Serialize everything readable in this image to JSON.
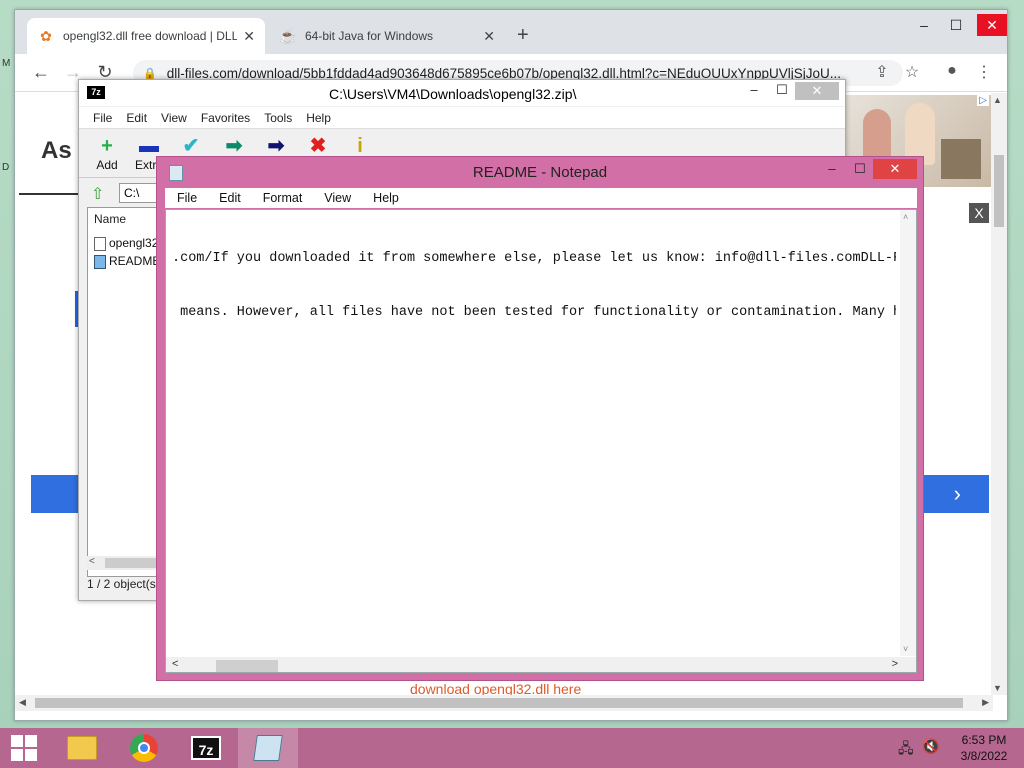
{
  "desktop": {
    "edge_labels": [
      "M",
      "D"
    ]
  },
  "browser": {
    "tabs": [
      {
        "title": "opengl32.dll free download | DLL",
        "icon": "dll-files-gear-icon"
      },
      {
        "title": "64-bit Java for Windows",
        "icon": "java-icon"
      }
    ],
    "new_tab": "+",
    "url": "dll-files.com/download/5bb1fddad4ad903648d675895ce6b07b/opengl32.dll.html?c=NEduOUUxYnppUVljSjJoU...",
    "controls": {
      "minimize": "–",
      "maximize": "☐",
      "close": "✕"
    },
    "page": {
      "heading": "As",
      "heading_mark": "l",
      "band_letter": "D",
      "band_arrow": "›",
      "ad_badge": "▷",
      "ad_close": "X",
      "link_text": "download opengl32.dll here"
    }
  },
  "zip": {
    "title": "C:\\Users\\VM4\\Downloads\\opengl32.zip\\",
    "menu": [
      "File",
      "Edit",
      "View",
      "Favorites",
      "Tools",
      "Help"
    ],
    "tools": [
      {
        "label": "Add",
        "icon": "+",
        "color": "#22b14c"
      },
      {
        "label": "Extra",
        "icon": "▬",
        "color": "#1a33b8"
      },
      {
        "label": "",
        "icon": "✔",
        "color": "#2bb5c9"
      },
      {
        "label": "",
        "icon": "➡",
        "color": "#0b8b6a"
      },
      {
        "label": "",
        "icon": "➡",
        "color": "#12136f"
      },
      {
        "label": "",
        "icon": "✖",
        "color": "#e01f1f"
      },
      {
        "label": "",
        "icon": "i",
        "color": "#c8a500"
      }
    ],
    "address": "C:\\",
    "columns": [
      "Name"
    ],
    "files": [
      {
        "name": "opengl32",
        "icon": "file-icon"
      },
      {
        "name": "README",
        "icon": "text-file-icon"
      }
    ],
    "status": "1 / 2 object(s"
  },
  "notepad": {
    "title": "README - Notepad",
    "menu": [
      "File",
      "Edit",
      "Format",
      "View",
      "Help"
    ],
    "lines": [
      ".com/If you downloaded it from somewhere else, please let us know: info@dll-files.comDLL-F",
      " means. However, all files have not been tested for functionality or contamination. Many ha"
    ],
    "controls": {
      "minimize": "–",
      "maximize": "☐",
      "close": "✕"
    }
  },
  "taskbar": {
    "apps": [
      "File Explorer",
      "Google Chrome",
      "7-Zip",
      "Notepad"
    ],
    "time": "6:53 PM",
    "date": "3/8/2022"
  },
  "colors": {
    "notepad_frame": "#d26fa7",
    "taskbar": "#b5678f",
    "link": "#e05a2c",
    "blue_band": "#2f6fdf"
  }
}
